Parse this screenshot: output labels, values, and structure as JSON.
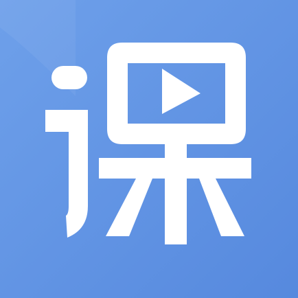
{
  "app_icon": {
    "icon": "course-video-icon",
    "glyph": "课",
    "colors": {
      "background": "#5b8ee2",
      "background_highlight": "#6d9ce7",
      "foreground": "#ffffff"
    }
  }
}
